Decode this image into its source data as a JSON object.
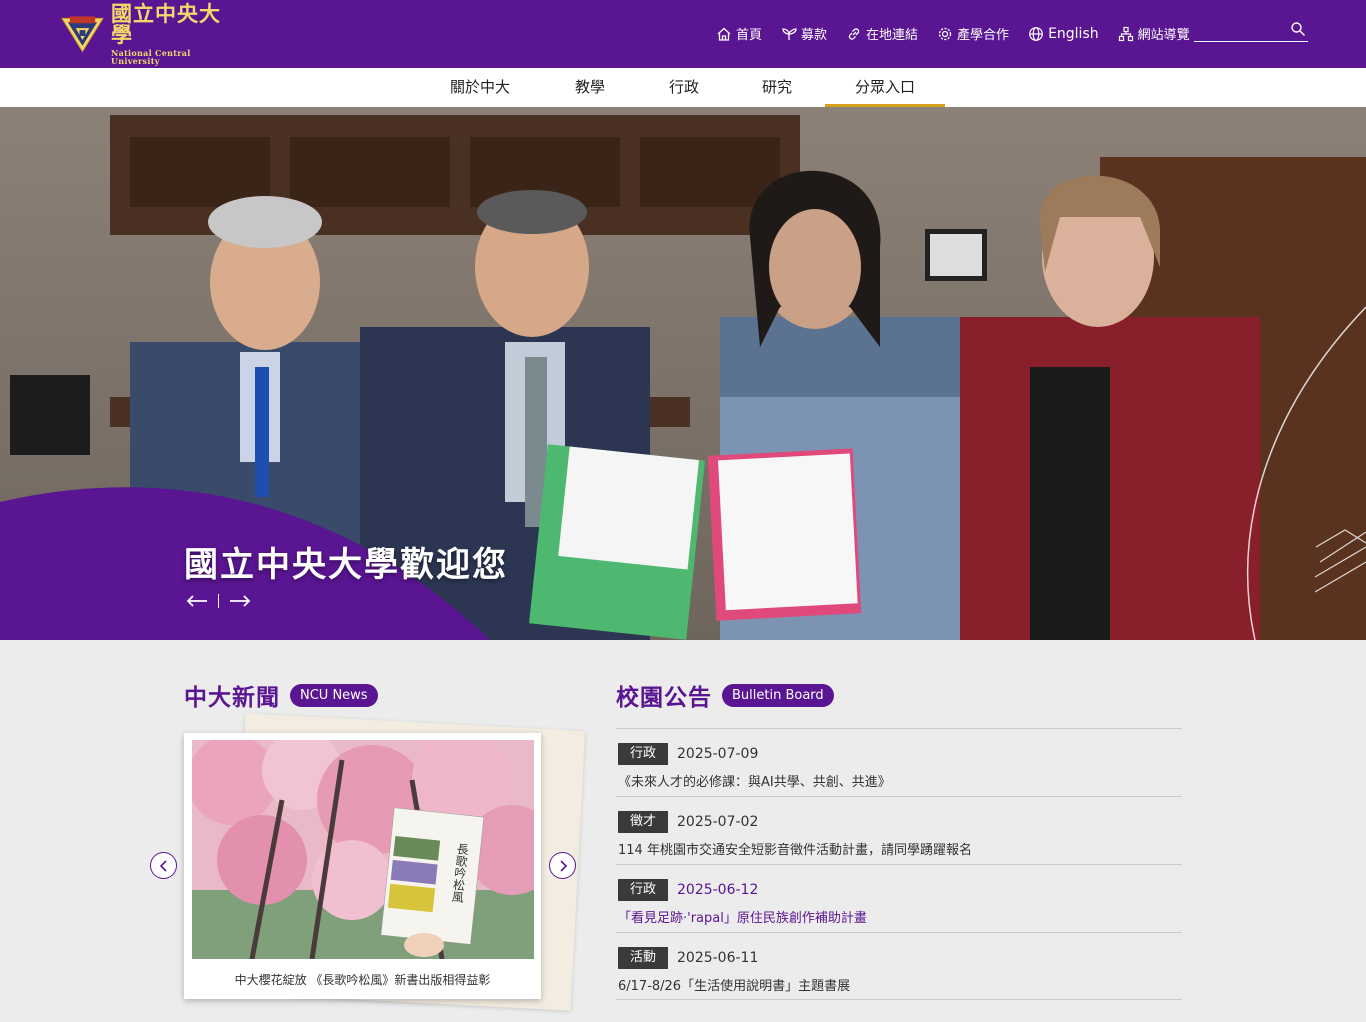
{
  "header": {
    "logo": {
      "zh": "國立中央大學",
      "en": "National Central University"
    },
    "links": [
      {
        "label": "首頁",
        "icon": "home-icon"
      },
      {
        "label": "募款",
        "icon": "sprout-icon"
      },
      {
        "label": "在地連結",
        "icon": "link-icon"
      },
      {
        "label": "產學合作",
        "icon": "gear-icon"
      },
      {
        "label": "English",
        "icon": "globe-icon"
      },
      {
        "label": "網站導覽",
        "icon": "sitemap-icon"
      }
    ],
    "search": {
      "placeholder": "",
      "icon": "search-icon"
    }
  },
  "nav": {
    "items": [
      {
        "label": "關於中大"
      },
      {
        "label": "教學"
      },
      {
        "label": "行政"
      },
      {
        "label": "研究"
      },
      {
        "label": "分眾入口",
        "active": true
      }
    ]
  },
  "hero": {
    "title": "國立中央大學歡迎您",
    "prev_icon": "arrow-left-icon",
    "next_icon": "arrow-right-icon"
  },
  "news": {
    "title": "中大新聞",
    "badge": "NCU News",
    "caption": "中大櫻花綻放 《長歌吟松風》新書出版相得益彰",
    "book_title": "長歌吟松風"
  },
  "bulletin": {
    "title": "校園公告",
    "badge": "Bulletin Board",
    "items": [
      {
        "tag": "行政",
        "date": "2025-07-09",
        "text": "《未來人才的必修課：與AI共學、共創、共進》",
        "highlight": false
      },
      {
        "tag": "徵才",
        "date": "2025-07-02",
        "text": "114 年桃園市交通安全短影音徵件活動計畫，請同學踴躍報名",
        "highlight": false
      },
      {
        "tag": "行政",
        "date": "2025-06-12",
        "text": "「看見足跡·'rapal」原住民族創作補助計畫",
        "highlight": true
      },
      {
        "tag": "活動",
        "date": "2025-06-11",
        "text": "6/17-8/26「生活使用說明書」主題書展",
        "highlight": false
      }
    ]
  },
  "colors": {
    "brand_purple": "#5a1592",
    "accent_gold": "#d6a01c",
    "logo_gold": "#f5d66b"
  }
}
